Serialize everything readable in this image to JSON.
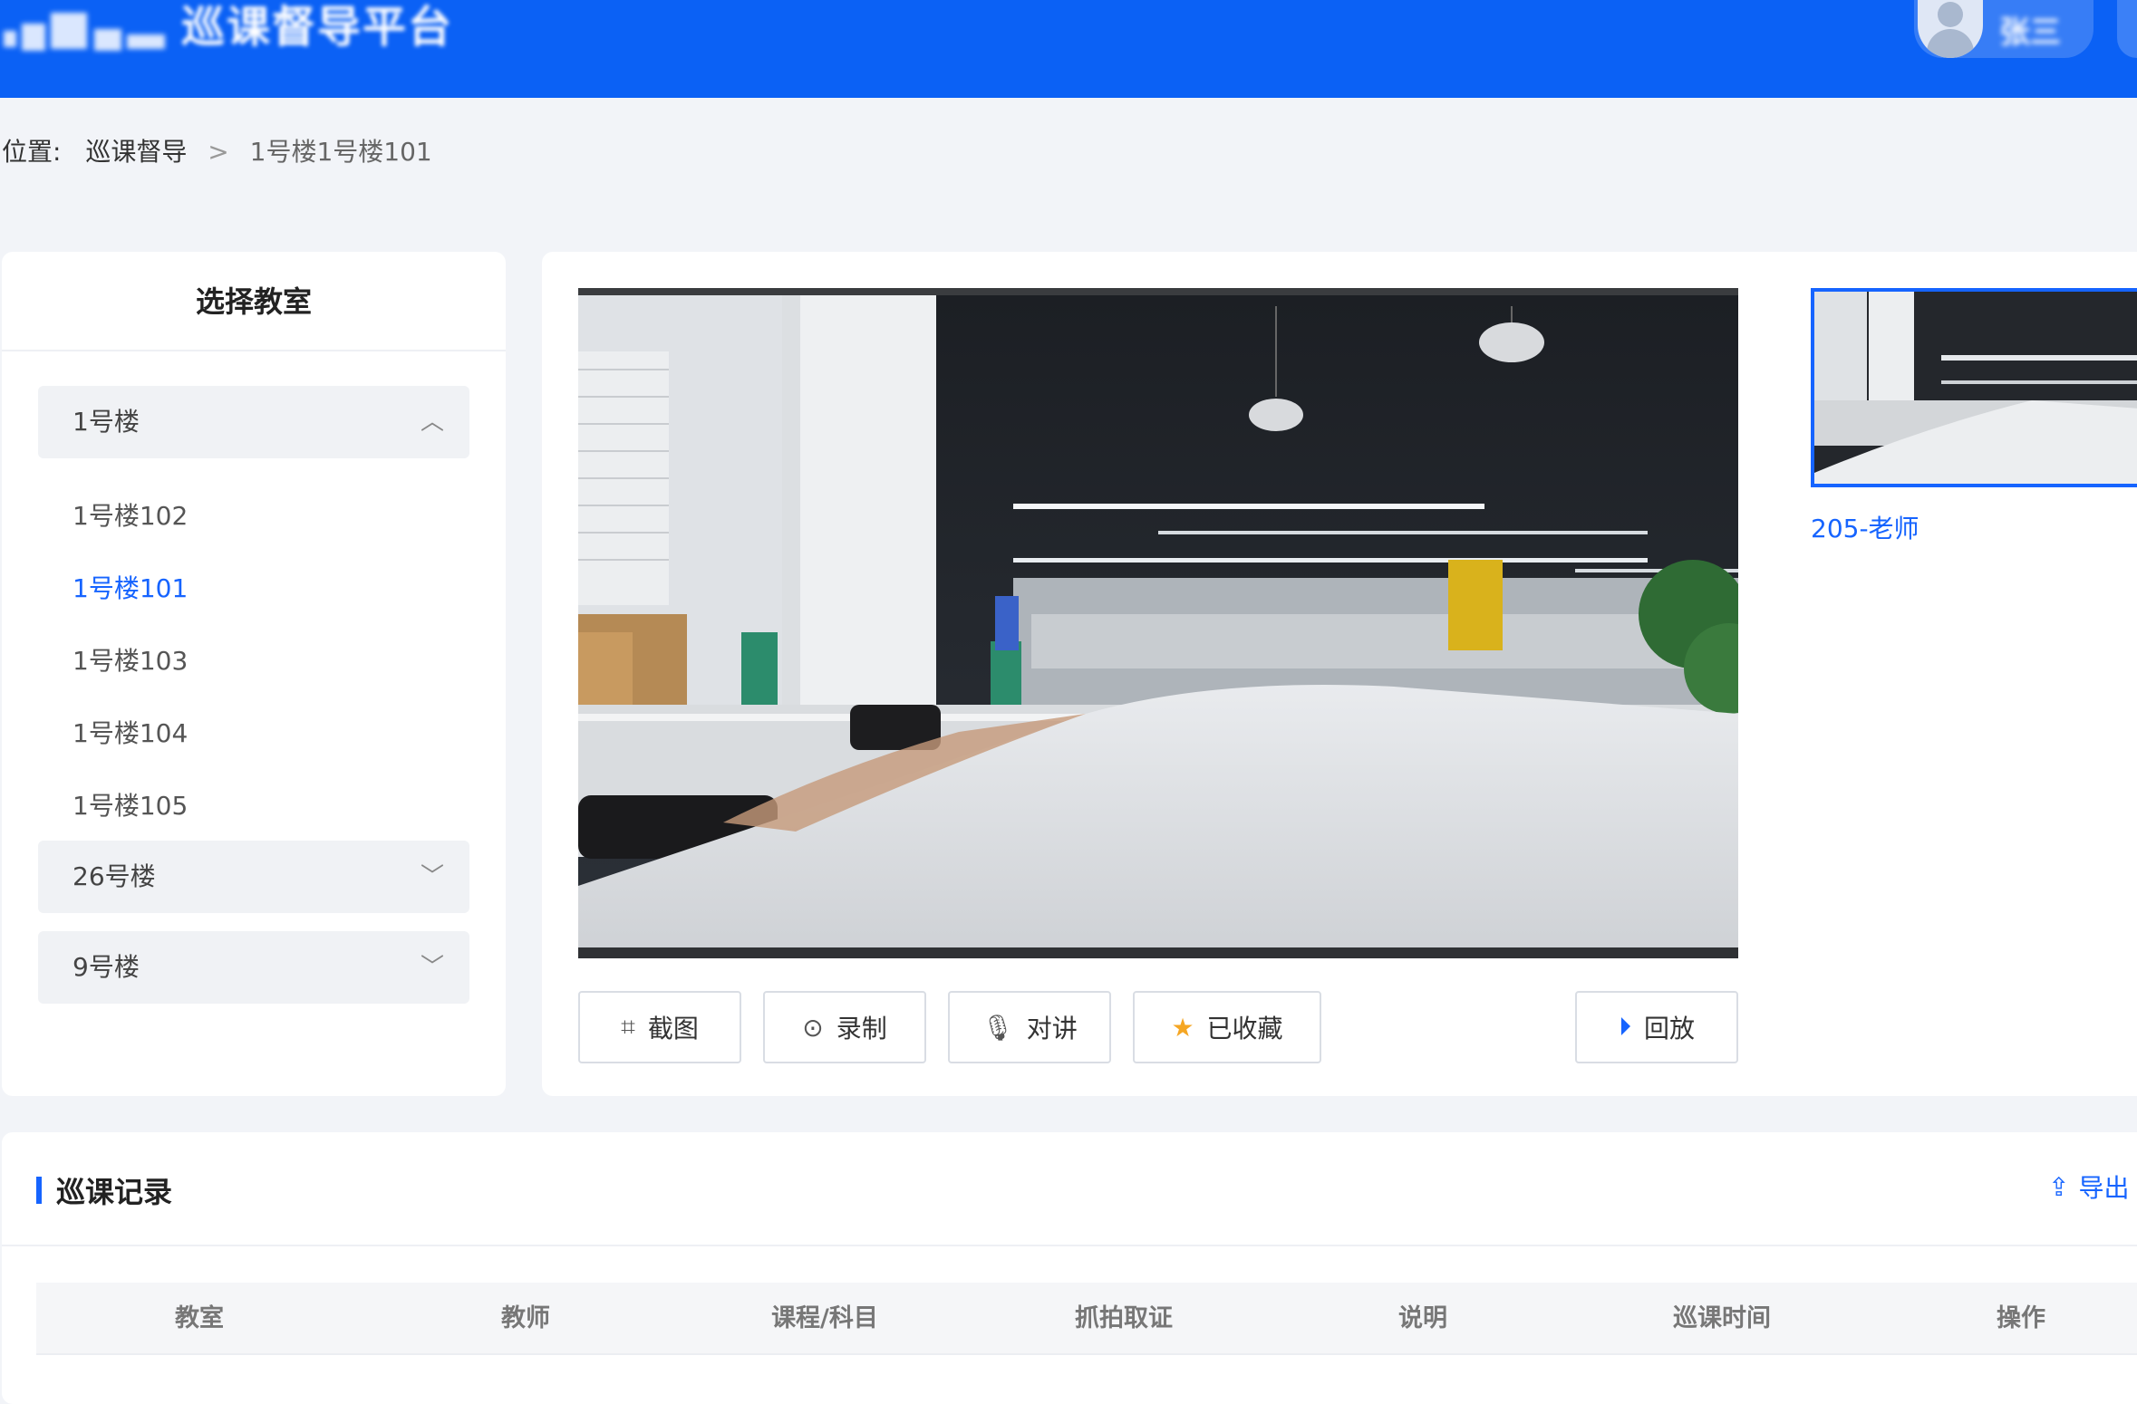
{
  "header": {
    "app_title": "巡课督导平台",
    "user_name": "张三"
  },
  "breadcrumb": {
    "prefix": "位置:",
    "items": [
      "巡课督导",
      "1号楼1号楼101"
    ],
    "separator": ">"
  },
  "sidebar": {
    "title": "选择教室",
    "buildings": [
      {
        "name": "1号楼",
        "expanded": true,
        "rooms": [
          "1号楼102",
          "1号楼101",
          "1号楼103",
          "1号楼104",
          "1号楼105"
        ],
        "active_room": "1号楼101"
      },
      {
        "name": "26号楼",
        "expanded": false
      },
      {
        "name": "9号楼",
        "expanded": false
      }
    ]
  },
  "player": {
    "controls": {
      "screenshot": "截图",
      "record": "录制",
      "intercom": "对讲",
      "favorited": "已收藏",
      "playback": "回放"
    },
    "thumbnails": [
      {
        "label": "205-老师",
        "selected": true
      }
    ]
  },
  "records": {
    "title": "巡课记录",
    "export_label": "导出",
    "columns": [
      "教室",
      "教师",
      "课程/科目",
      "抓拍取证",
      "说明",
      "巡课时间",
      "操作"
    ]
  },
  "colors": {
    "header_bg": "#0b61f5",
    "accent": "#1664ff",
    "page_bg": "#f2f4f8",
    "star": "#f5a623"
  }
}
